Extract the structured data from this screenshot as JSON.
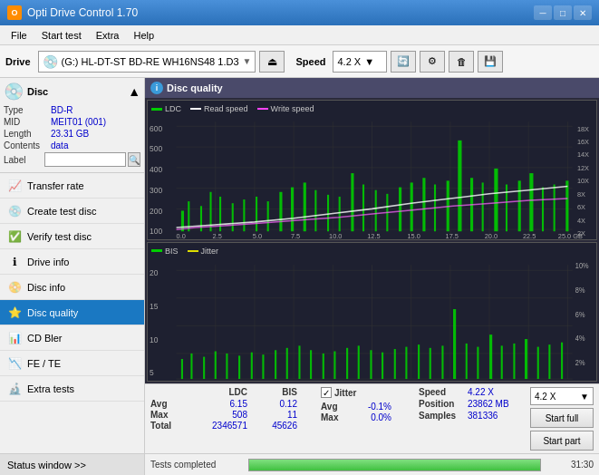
{
  "titlebar": {
    "title": "Opti Drive Control 1.70",
    "icon": "O",
    "minimize": "─",
    "maximize": "□",
    "close": "✕"
  },
  "menubar": {
    "items": [
      "File",
      "Start test",
      "Extra",
      "Help"
    ]
  },
  "toolbar": {
    "drive_label": "Drive",
    "drive_icon": "💿",
    "drive_text": "(G:)  HL-DT-ST BD-RE  WH16NS48 1.D3",
    "eject_icon": "⏏",
    "speed_label": "Speed",
    "speed_value": "4.2 X"
  },
  "disc": {
    "title": "Disc",
    "type_label": "Type",
    "type_value": "BD-R",
    "mid_label": "MID",
    "mid_value": "MEIT01 (001)",
    "length_label": "Length",
    "length_value": "23.31 GB",
    "contents_label": "Contents",
    "contents_value": "data",
    "label_label": "Label"
  },
  "nav": {
    "items": [
      {
        "id": "transfer-rate",
        "label": "Transfer rate",
        "icon": "📈"
      },
      {
        "id": "create-test-disc",
        "label": "Create test disc",
        "icon": "💿"
      },
      {
        "id": "verify-test-disc",
        "label": "Verify test disc",
        "icon": "✅"
      },
      {
        "id": "drive-info",
        "label": "Drive info",
        "icon": "ℹ️"
      },
      {
        "id": "disc-info",
        "label": "Disc info",
        "icon": "📀"
      },
      {
        "id": "disc-quality",
        "label": "Disc quality",
        "icon": "⭐",
        "active": true
      },
      {
        "id": "cd-bler",
        "label": "CD Bler",
        "icon": "📊"
      },
      {
        "id": "fe-te",
        "label": "FE / TE",
        "icon": "📉"
      },
      {
        "id": "extra-tests",
        "label": "Extra tests",
        "icon": "🔬"
      }
    ],
    "status_window": "Status window >>"
  },
  "chart": {
    "title": "Disc quality",
    "title_icon": "i",
    "legend": {
      "ldc": "LDC",
      "ldc_color": "#00ff00",
      "read_speed": "Read speed",
      "read_speed_color": "#ffffff",
      "write_speed": "Write speed",
      "write_speed_color": "#ff00ff"
    },
    "legend2": {
      "bis": "BIS",
      "bis_color": "#00ff00",
      "jitter": "Jitter",
      "jitter_color": "#ffff00"
    },
    "top_y_max": "600",
    "top_y_labels": [
      "600",
      "500",
      "400",
      "300",
      "200",
      "100"
    ],
    "top_y_right": [
      "18X",
      "16X",
      "14X",
      "12X",
      "10X",
      "8X",
      "6X",
      "4X",
      "2X"
    ],
    "bottom_y_labels": [
      "20",
      "15",
      "10",
      "5"
    ],
    "bottom_y_right": [
      "10%",
      "8%",
      "6%",
      "4%",
      "2%"
    ],
    "x_labels": [
      "0.0",
      "2.5",
      "5.0",
      "7.5",
      "10.0",
      "12.5",
      "15.0",
      "17.5",
      "20.0",
      "22.5",
      "25.0 GB"
    ]
  },
  "stats": {
    "headers": [
      "LDC",
      "BIS"
    ],
    "rows": [
      {
        "label": "Avg",
        "ldc": "6.15",
        "bis": "0.12"
      },
      {
        "label": "Max",
        "ldc": "508",
        "bis": "11"
      },
      {
        "label": "Total",
        "ldc": "2346571",
        "bis": "45626"
      }
    ],
    "jitter": {
      "checked": true,
      "label": "Jitter",
      "rows": [
        {
          "label": "Avg",
          "value": "-0.1%"
        },
        {
          "label": "Max",
          "value": "0.0%"
        }
      ]
    },
    "speed": {
      "label": "Speed",
      "value": "4.22 X",
      "position_label": "Position",
      "position_value": "23862 MB",
      "samples_label": "Samples",
      "samples_value": "381336",
      "speed_select": "4.2 X"
    }
  },
  "actions": {
    "start_full": "Start full",
    "start_part": "Start part"
  },
  "progress": {
    "status": "Tests completed",
    "percent": "100.0%",
    "fill_width": 100,
    "time": "31:30"
  }
}
